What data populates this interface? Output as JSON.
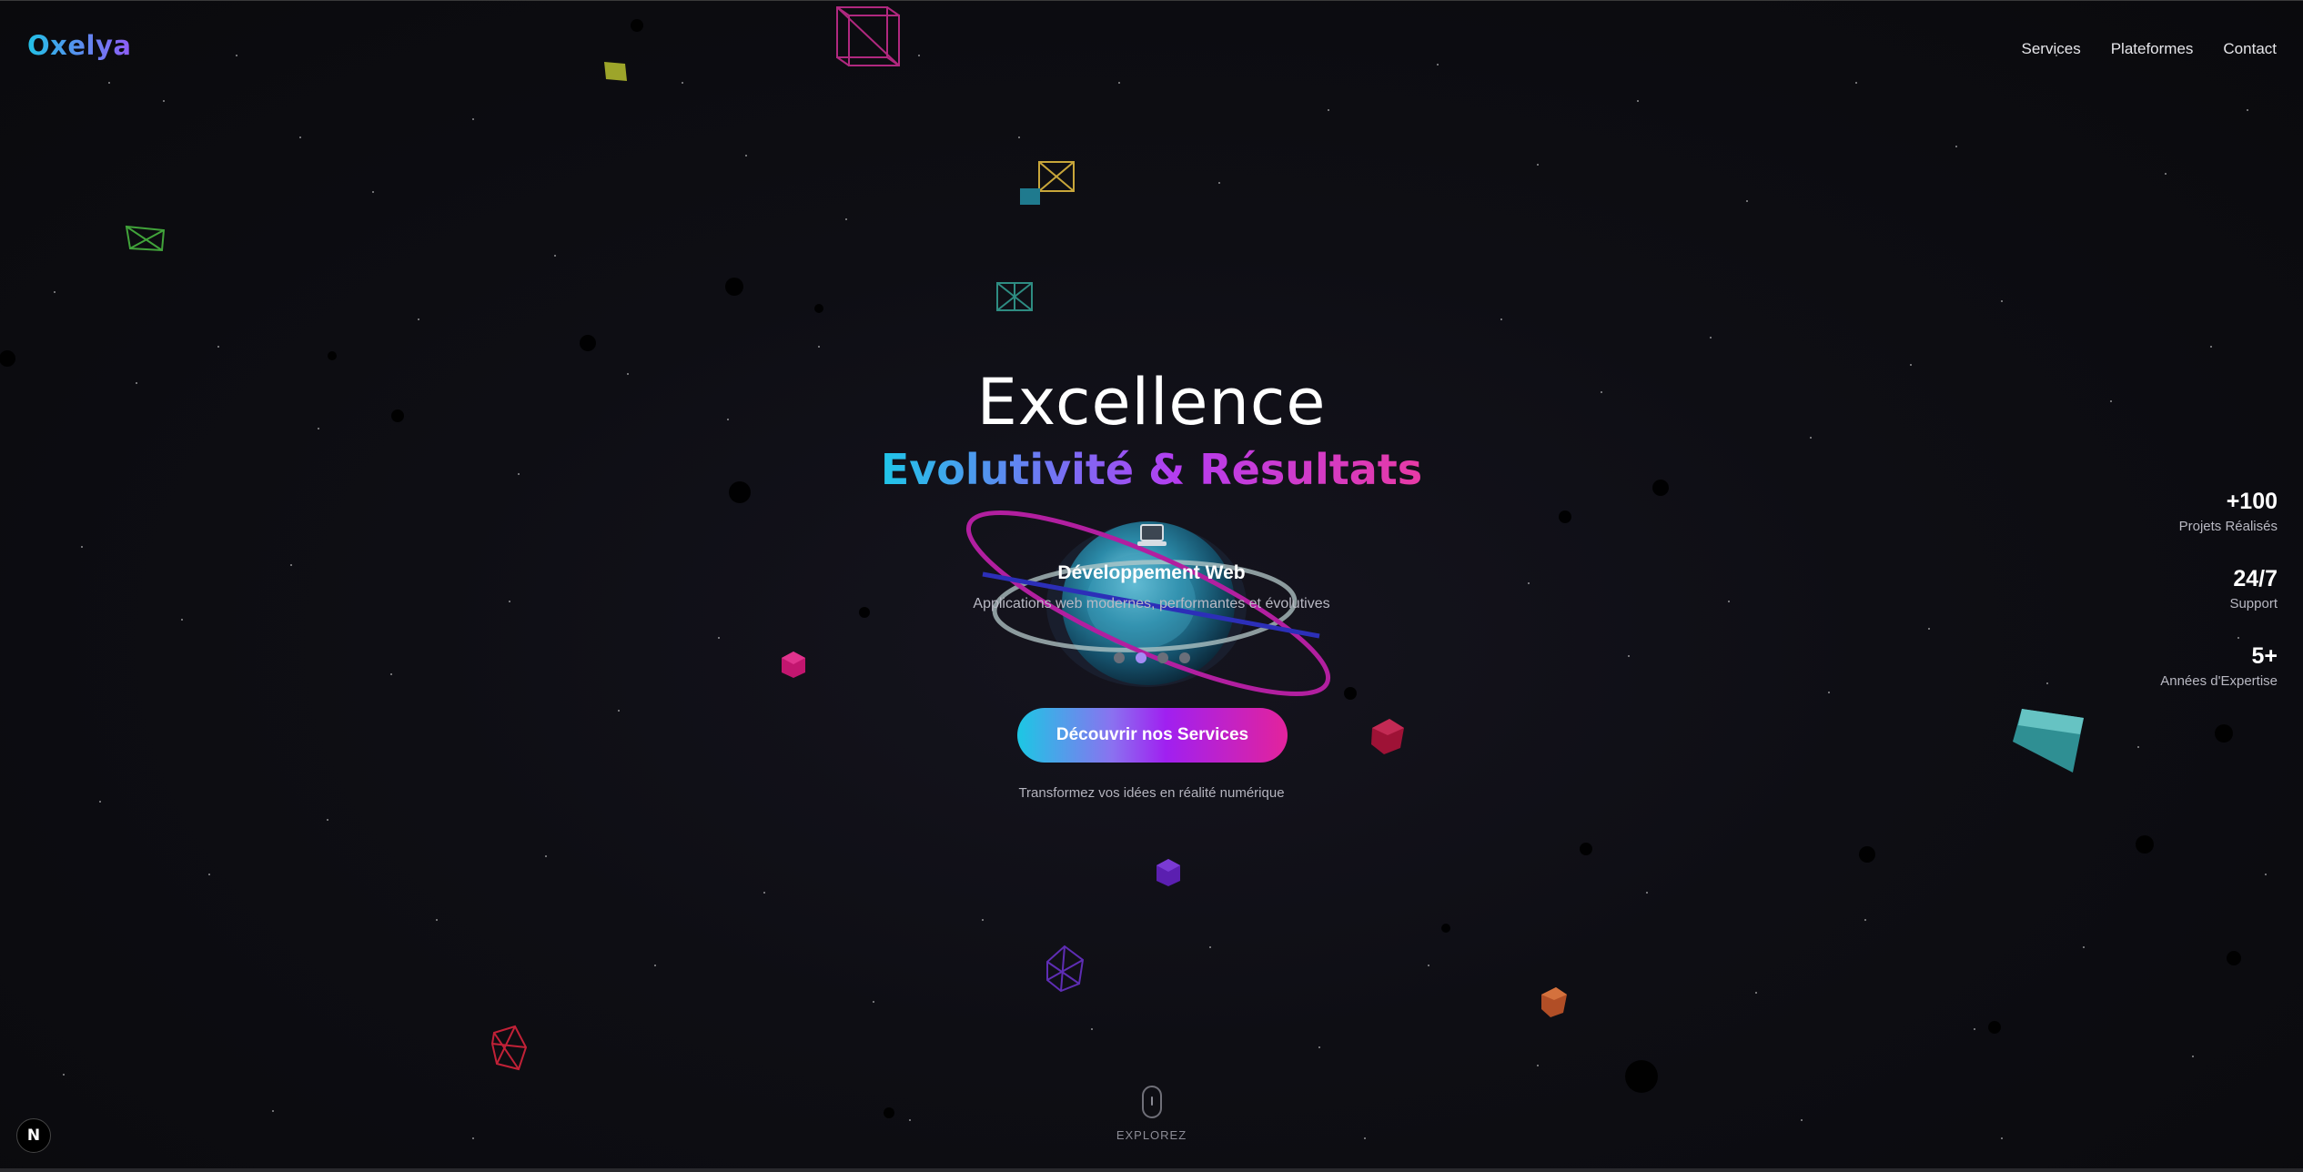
{
  "brand": {
    "logo_text": "Oxelya"
  },
  "nav": {
    "items": [
      {
        "label": "Services"
      },
      {
        "label": "Plateformes"
      },
      {
        "label": "Contact"
      }
    ]
  },
  "hero": {
    "title": "Excellence",
    "subtitle": "Evolutivité & Résultats",
    "service": {
      "icon": "laptop-icon",
      "title": "Développement Web",
      "description": "Applications web modernes, performantes et évolutives"
    },
    "carousel": {
      "count": 4,
      "active_index": 1
    },
    "cta_label": "Découvrir nos Services",
    "tagline": "Transformez vos idées en réalité numérique"
  },
  "stats": [
    {
      "value": "+100",
      "label": "Projets Réalisés"
    },
    {
      "value": "24/7",
      "label": "Support"
    },
    {
      "value": "5+",
      "label": "Années d'Expertise"
    }
  ],
  "scroll_indicator": {
    "label": "EXPLOREZ",
    "icon": "mouse-icon"
  },
  "dev_badge": {
    "label": "N",
    "icon": "nextjs-icon"
  },
  "colors": {
    "background": "#0b0b0f",
    "accent_cyan": "#1fc6e8",
    "accent_purple": "#a020f0",
    "accent_pink": "#e3239c"
  }
}
